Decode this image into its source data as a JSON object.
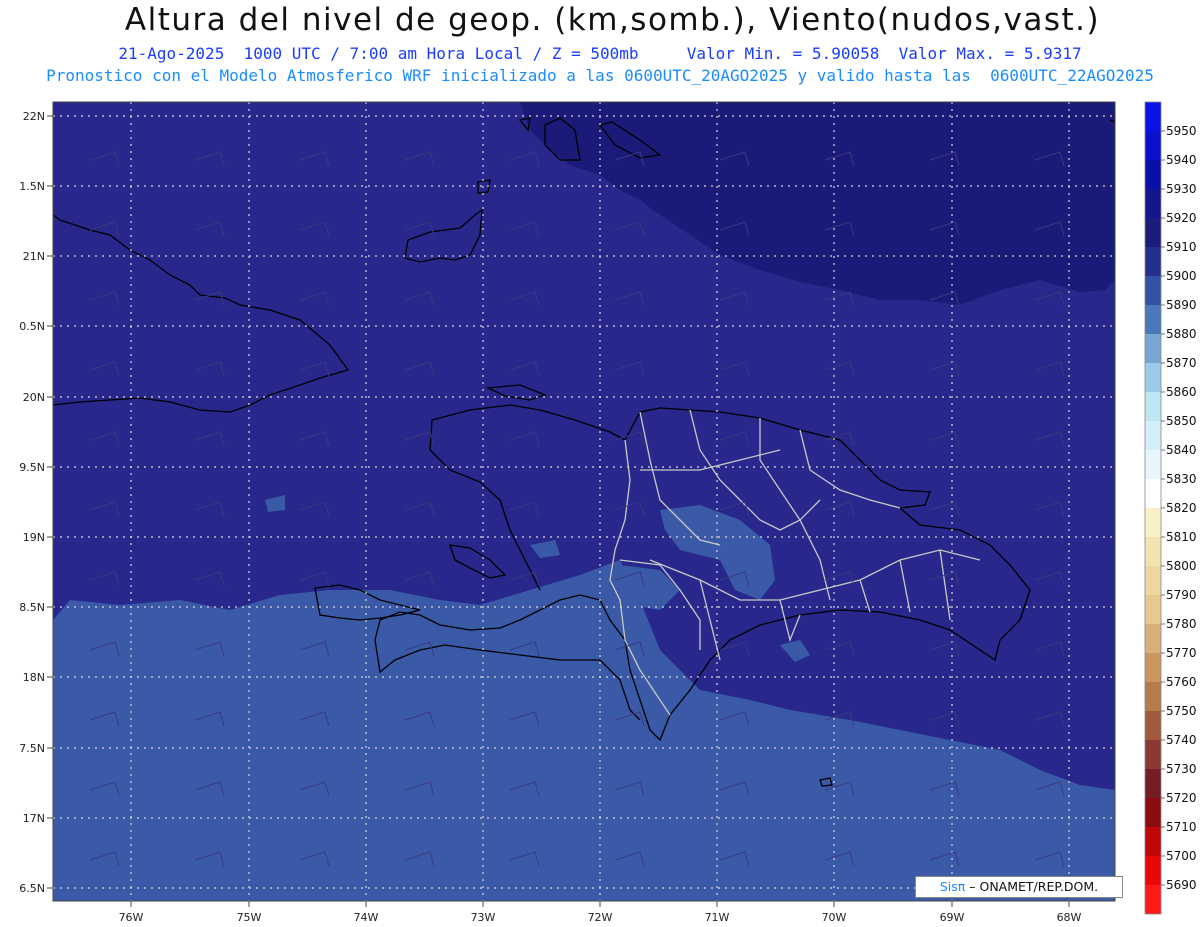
{
  "header": {
    "title": "Altura del nivel de geop. (km,somb.), Viento(nudos,vast.)",
    "line1": "21-Ago-2025  1000 UTC / 7:00 am Hora Local / Z = 500mb     Valor Min. = 5.90058  Valor Max. = 5.9317",
    "line2": "Pronostico con el Modelo Atmosferico WRF inicializado a las 0600UTC_20AGO2025 y valido hasta las  0600UTC_22AGO2025"
  },
  "map": {
    "lon_range": [
      -76.7,
      -67.6
    ],
    "lat_range": [
      6.4,
      22.2
    ],
    "lon_ticks": [
      "76W",
      "75W",
      "74W",
      "73W",
      "72W",
      "71W",
      "70W",
      "69W",
      "68W"
    ],
    "lat_ticks": [
      "22N",
      "1.5N",
      "21N",
      "0.5N",
      "20N",
      "9.5N",
      "19N",
      "8.5N",
      "18N",
      "7.5N",
      "17N",
      "6.5N"
    ],
    "shading_colors": {
      "dominant": "#27278c",
      "northeast_darker": "#1a1a78",
      "south_band": "#3a5aa8"
    },
    "coastline_color": "#000000",
    "province_border_color": "#c8c8c8",
    "gridline_color": "#d8d8d8"
  },
  "colorbar": {
    "levels": [
      "5950",
      "5940",
      "5930",
      "5920",
      "5910",
      "5900",
      "5890",
      "5880",
      "5870",
      "5860",
      "5850",
      "5840",
      "5830",
      "5820",
      "5810",
      "5800",
      "5790",
      "5780",
      "5770",
      "5760",
      "5750",
      "5740",
      "5730",
      "5720",
      "5710",
      "5700",
      "5690"
    ],
    "colors": [
      "#0a12e8",
      "#0a10cc",
      "#0a0fa8",
      "#15158c",
      "#1c1c7a",
      "#24308e",
      "#3451a4",
      "#4a78b8",
      "#78a6d2",
      "#9ccaea",
      "#bde6f2",
      "#d4eef8",
      "#e8f6fb",
      "#ffffff",
      "#f8f0c8",
      "#f2e4b0",
      "#ecd7a0",
      "#e6c890",
      "#d9b07a",
      "#c99660",
      "#b47c4c",
      "#a05a3c",
      "#8a3a30",
      "#761c24",
      "#8a0c10",
      "#c00808",
      "#e80808",
      "#ff1a1a"
    ]
  },
  "credit": {
    "logo": "Sisπ",
    "text": " – ONAMET/REP.DOM."
  }
}
